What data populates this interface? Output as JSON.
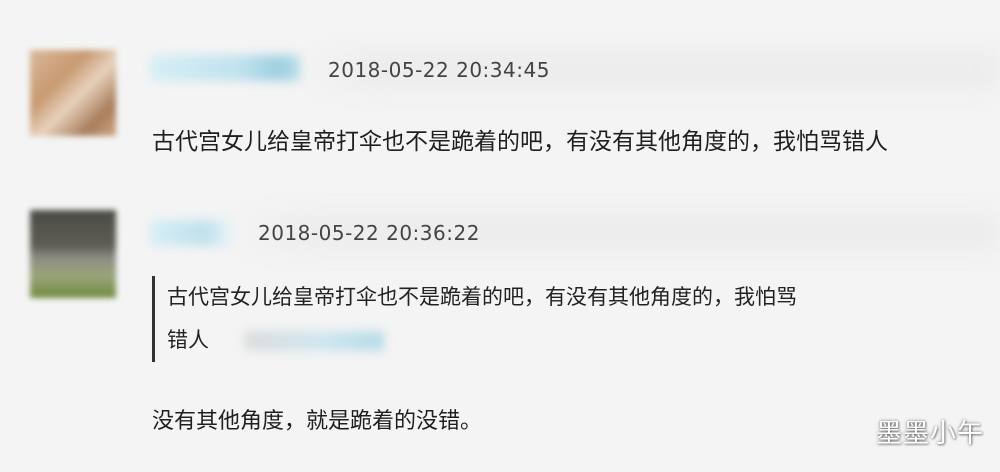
{
  "comments": [
    {
      "timestamp": "2018-05-22 20:34:45",
      "text": "古代宫女儿给皇帝打伞也不是跪着的吧，有没有其他角度的，我怕骂错人"
    },
    {
      "timestamp": "2018-05-22 20:36:22",
      "quote_lines": [
        "古代宫女儿给皇帝打伞也不是跪着的吧，有没有其他角度的，我怕骂",
        "错人"
      ],
      "text": "没有其他角度，就是跪着的没错。"
    }
  ],
  "watermark": "墨墨小午",
  "colors": {
    "background": "#f4f4f4",
    "text": "#1f1f1f",
    "timestamp": "#444444"
  }
}
